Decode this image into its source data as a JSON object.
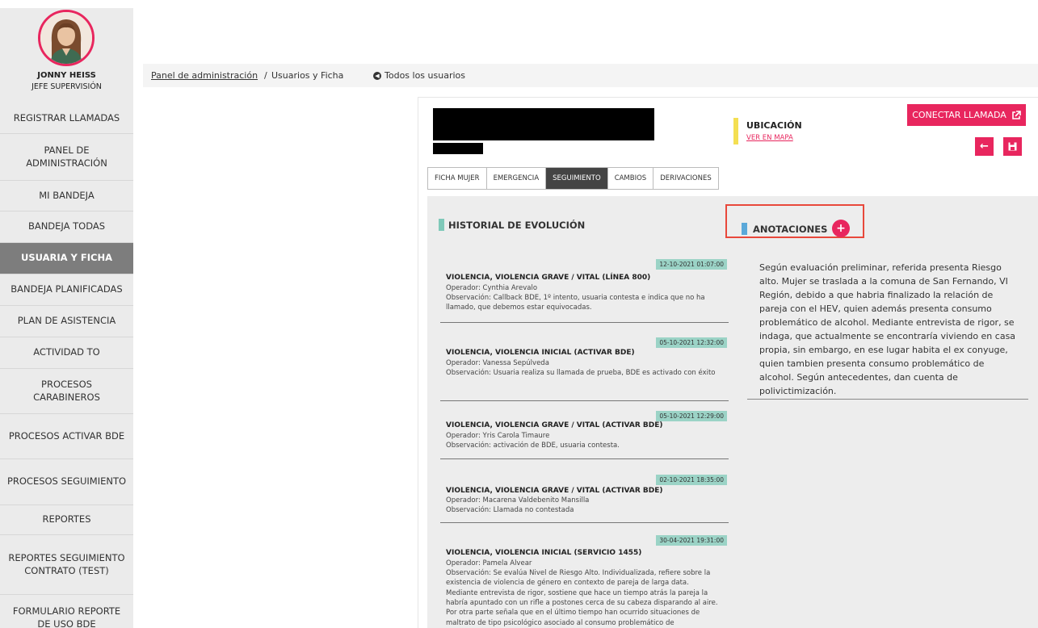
{
  "user": {
    "name": "JONNY HEISS",
    "role": "JEFE SUPERVISIÓN"
  },
  "sidebar": {
    "items": [
      {
        "label": "REGISTRAR LLAMADAS",
        "active": false
      },
      {
        "label": "PANEL DE ADMINISTRACIÓN",
        "active": false
      },
      {
        "label": "MI BANDEJA",
        "active": false
      },
      {
        "label": "BANDEJA TODAS",
        "active": false
      },
      {
        "label": "USUARIA Y FICHA",
        "active": true
      },
      {
        "label": "BANDEJA PLANIFICADAS",
        "active": false
      },
      {
        "label": "PLAN DE ASISTENCIA",
        "active": false
      },
      {
        "label": "ACTIVIDAD TO",
        "active": false
      },
      {
        "label": "PROCESOS CARABINEROS",
        "active": false
      },
      {
        "label": "PROCESOS ACTIVAR BDE",
        "active": false
      },
      {
        "label": "PROCESOS SEGUIMIENTO",
        "active": false
      },
      {
        "label": "REPORTES",
        "active": false
      },
      {
        "label": "REPORTES SEGUIMIENTO CONTRATO (TEST)",
        "active": false
      },
      {
        "label": "FORMULARIO REPORTE DE USO BDE",
        "active": false
      }
    ]
  },
  "breadcrumb": {
    "link": "Panel de administración",
    "separator": "/",
    "current": "Usuarios y Ficha",
    "all_users": "Todos los usuarios"
  },
  "location": {
    "title": "UBICACIÓN",
    "map_link": "VER EN MAPA"
  },
  "actions": {
    "call_label": "CONECTAR LLAMADA"
  },
  "tabs": [
    {
      "label": "FICHA MUJER",
      "active": false
    },
    {
      "label": "EMERGENCIA",
      "active": false
    },
    {
      "label": "SEGUIMIENTO",
      "active": true
    },
    {
      "label": "CAMBIOS",
      "active": false
    },
    {
      "label": "DERIVACIONES",
      "active": false
    }
  ],
  "history": {
    "title": "HISTORIAL DE EVOLUCIÓN",
    "entries": [
      {
        "date": "12-10-2021 01:07:00",
        "title": "VIOLENCIA, VIOLENCIA GRAVE / VITAL (LÍNEA 800)",
        "operator": "Operador: Cynthia Arevalo",
        "observation": "Observación: Callback BDE, 1º intento, usuaria contesta e indica que no ha llamado, que debemos estar equivocadas."
      },
      {
        "date": "05-10-2021 12:32:00",
        "title": "VIOLENCIA, VIOLENCIA INICIAL (ACTIVAR BDE)",
        "operator": "Operador: Vanessa Sepúlveda",
        "observation": "Observación: Usuaria realiza su llamada de prueba, BDE es activado con éxito"
      },
      {
        "date": "05-10-2021 12:29:00",
        "title": "VIOLENCIA, VIOLENCIA GRAVE / VITAL (ACTIVAR BDE)",
        "operator": "Operador: Yris Carola Timaure",
        "observation": "Observación: activación de BDE, usuaria contesta."
      },
      {
        "date": "02-10-2021 18:35:00",
        "title": "VIOLENCIA, VIOLENCIA GRAVE / VITAL (ACTIVAR BDE)",
        "operator": "Operador: Macarena Valdebenito Mansilla",
        "observation": "Observación: Llamada no contestada"
      },
      {
        "date": "30-04-2021 19:31:00",
        "title": "VIOLENCIA, VIOLENCIA INICIAL (SERVICIO 1455)",
        "operator": "Operador: Pamela Alvear",
        "observation": "Observación: Se evalúa Nivel de Riesgo Alto. Individualizada, refiere sobre la existencia de violencia de género en contexto de pareja de larga data. Mediante entrevista de rigor, sostiene que hace un tiempo atrás la pareja la habría apuntado con un rifle a postones cerca de su cabeza disparando al aire. Por otra parte señala que en el último tiempo han ocurrido situaciones de maltrato de tipo psicológico asociado al consumo problemático de"
      }
    ]
  },
  "annotations": {
    "title": "ANOTACIONES",
    "add_label": "+",
    "text": "Según evaluación preliminar, referida presenta Riesgo alto. Mujer se traslada a la comuna de San Fernando, VI Región, debido a que habria finalizado la relación de pareja con el HEV, quien además presenta consumo problemático de alcohol. Mediante entrevista de rigor, se indaga, que actualmente se encontraría viviendo en casa propia, sin embargo, en ese lugar habita el ex conyuge, quien tambien presenta consumo problemático de alcohol. Según antecedentes, dan cuenta de polivictimización."
  },
  "colors": {
    "accent": "#e8265e",
    "history_marker": "#7fc9b9",
    "annotations_marker": "#5ba8d9",
    "location_marker": "#f4df52",
    "highlight_box": "#e8483b"
  }
}
